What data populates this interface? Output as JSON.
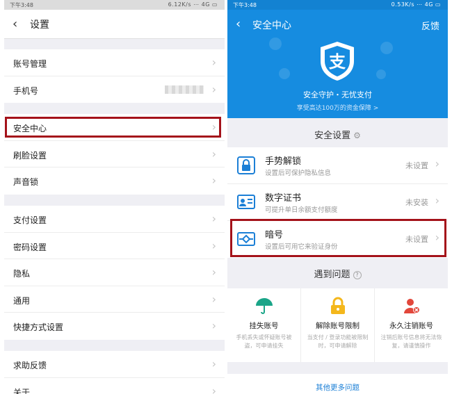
{
  "left": {
    "status": {
      "time": "下午3:48",
      "info": "6.12K/s ⋯ 4G ▭"
    },
    "nav": {
      "back": "‹",
      "title": "设置"
    },
    "groups": [
      [
        "账号管理",
        "手机号"
      ],
      [
        "安全中心",
        "刷脸设置",
        "声音锁"
      ],
      [
        "支付设置",
        "密码设置",
        "隐私",
        "通用",
        "快捷方式设置"
      ],
      [
        "求助反馈",
        "关于"
      ]
    ],
    "chevron": "›"
  },
  "right": {
    "status": {
      "time": "下午3:48",
      "info": "0.53K/s ⋯ 4G ▭"
    },
    "nav": {
      "back": "‹",
      "title": "安全中心",
      "feedback": "反馈"
    },
    "hero": {
      "logo_char": "支",
      "slogan": "安全守护・无忧支付",
      "subslogan": "享受高达100万的资金保障 >"
    },
    "security": {
      "header": "安全设置",
      "items": [
        {
          "name": "手势解锁",
          "desc": "设置后可保护隐私信息",
          "status": "未设置",
          "icon": "lock-icon"
        },
        {
          "name": "数字证书",
          "desc": "可提升单日余额支付额度",
          "status": "未安装",
          "icon": "certificate-icon"
        },
        {
          "name": "暗号",
          "desc": "设置后可用它来验证身份",
          "status": "未设置",
          "icon": "code-icon"
        }
      ]
    },
    "help": {
      "header": "遇到问题",
      "items": [
        {
          "name": "挂失账号",
          "desc": "手机丢失或怀疑账号被盗，可申请挂失",
          "icon": "umbrella-icon"
        },
        {
          "name": "解除账号限制",
          "desc": "当支付 / 登录功能被限制时，可申请解除",
          "icon": "padlock-icon"
        },
        {
          "name": "永久注销账号",
          "desc": "注销后账号信息将无法恢复，请谨慎操作",
          "icon": "user-delete-icon"
        }
      ],
      "more": "其他更多问题"
    },
    "colors": {
      "brand": "#168ce0",
      "highlight": "#a4121a"
    }
  }
}
